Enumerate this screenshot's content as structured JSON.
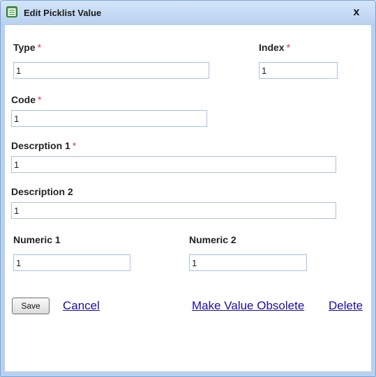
{
  "window": {
    "title": "Edit Picklist Value",
    "close_label": "x"
  },
  "form": {
    "type": {
      "label": "Type",
      "required_mark": "*",
      "value": "1"
    },
    "index": {
      "label": "Index",
      "required_mark": "*",
      "value": "1"
    },
    "code": {
      "label": "Code",
      "required_mark": "*",
      "value": "1"
    },
    "description1": {
      "label": "Descrption 1",
      "required_mark": "*",
      "value": "1"
    },
    "description2": {
      "label": "Description 2",
      "value": "1"
    },
    "numeric1": {
      "label": "Numeric 1",
      "value": "1"
    },
    "numeric2": {
      "label": "Numeric 2",
      "value": "1"
    }
  },
  "actions": {
    "save_label": "Save",
    "cancel_label": "Cancel",
    "obsolete_label": "Make Value Obsolete",
    "delete_label": "Delete"
  },
  "colors": {
    "required": "#e03030",
    "link": "#1a0dab",
    "titlebar": "#c6dcf5",
    "input_border": "#a9c2df"
  }
}
